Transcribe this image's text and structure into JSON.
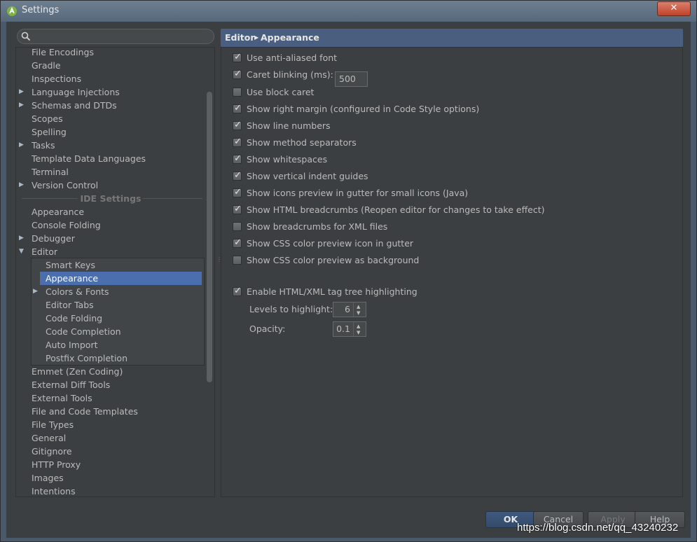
{
  "window": {
    "title": "Settings",
    "close_label": "✕"
  },
  "search": {
    "placeholder": ""
  },
  "tree": {
    "project_items": [
      {
        "label": "File Encodings",
        "arrow": ""
      },
      {
        "label": "Gradle",
        "arrow": ""
      },
      {
        "label": "Inspections",
        "arrow": ""
      },
      {
        "label": "Language Injections",
        "arrow": "▶"
      },
      {
        "label": "Schemas and DTDs",
        "arrow": "▶"
      },
      {
        "label": "Scopes",
        "arrow": ""
      },
      {
        "label": "Spelling",
        "arrow": ""
      },
      {
        "label": "Tasks",
        "arrow": "▶"
      },
      {
        "label": "Template Data Languages",
        "arrow": ""
      },
      {
        "label": "Terminal",
        "arrow": ""
      },
      {
        "label": "Version Control",
        "arrow": "▶"
      }
    ],
    "ide_header": "IDE Settings",
    "ide_items_top": [
      {
        "label": "Appearance",
        "arrow": ""
      },
      {
        "label": "Console Folding",
        "arrow": ""
      },
      {
        "label": "Debugger",
        "arrow": "▶"
      },
      {
        "label": "Editor",
        "arrow": "▼"
      }
    ],
    "editor_children": [
      {
        "label": "Smart Keys",
        "arrow": ""
      },
      {
        "label": "Appearance",
        "arrow": "",
        "selected": true
      },
      {
        "label": "Colors & Fonts",
        "arrow": "▶"
      },
      {
        "label": "Editor Tabs",
        "arrow": ""
      },
      {
        "label": "Code Folding",
        "arrow": ""
      },
      {
        "label": "Code Completion",
        "arrow": ""
      },
      {
        "label": "Auto Import",
        "arrow": ""
      },
      {
        "label": "Postfix Completion",
        "arrow": ""
      }
    ],
    "ide_items_bottom": [
      {
        "label": "Emmet (Zen Coding)",
        "arrow": ""
      },
      {
        "label": "External Diff Tools",
        "arrow": ""
      },
      {
        "label": "External Tools",
        "arrow": ""
      },
      {
        "label": "File and Code Templates",
        "arrow": ""
      },
      {
        "label": "File Types",
        "arrow": ""
      },
      {
        "label": "General",
        "arrow": ""
      },
      {
        "label": "Gitignore",
        "arrow": ""
      },
      {
        "label": "HTTP Proxy",
        "arrow": ""
      },
      {
        "label": "Images",
        "arrow": ""
      },
      {
        "label": "Intentions",
        "arrow": ""
      }
    ]
  },
  "header": {
    "crumb1": "Editor",
    "sep": "▶",
    "crumb2": "Appearance"
  },
  "options": [
    {
      "label": "Use anti-aliased font",
      "checked": true
    },
    {
      "label": "Caret blinking (ms):",
      "checked": true,
      "value": "500"
    },
    {
      "label": "Use block caret",
      "checked": false
    },
    {
      "label": "Show right margin (configured in Code Style options)",
      "checked": true
    },
    {
      "label": "Show line numbers",
      "checked": true
    },
    {
      "label": "Show method separators",
      "checked": true
    },
    {
      "label": "Show whitespaces",
      "checked": true
    },
    {
      "label": "Show vertical indent guides",
      "checked": true
    },
    {
      "label": "Show icons preview in gutter for small icons (Java)",
      "checked": true
    },
    {
      "label": "Show HTML breadcrumbs (Reopen editor for changes to take effect)",
      "checked": true
    },
    {
      "label": "Show breadcrumbs for XML files",
      "checked": false
    },
    {
      "label": "Show CSS color preview icon in gutter",
      "checked": true
    },
    {
      "label": "Show CSS color preview as background",
      "checked": false
    }
  ],
  "tag_tree": {
    "label": "Enable HTML/XML tag tree highlighting",
    "checked": true,
    "levels_label": "Levels to highlight:",
    "levels_value": "6",
    "opacity_label": "Opacity:",
    "opacity_value": "0.1"
  },
  "footer": {
    "ok": "OK",
    "cancel": "Cancel",
    "apply": "Apply",
    "help": "Help"
  },
  "watermark": "https://blog.csdn.net/qq_43240232",
  "colors": {
    "selection": "#4b6eaf",
    "header": "#4a5f7f",
    "background": "#3c3f41"
  }
}
